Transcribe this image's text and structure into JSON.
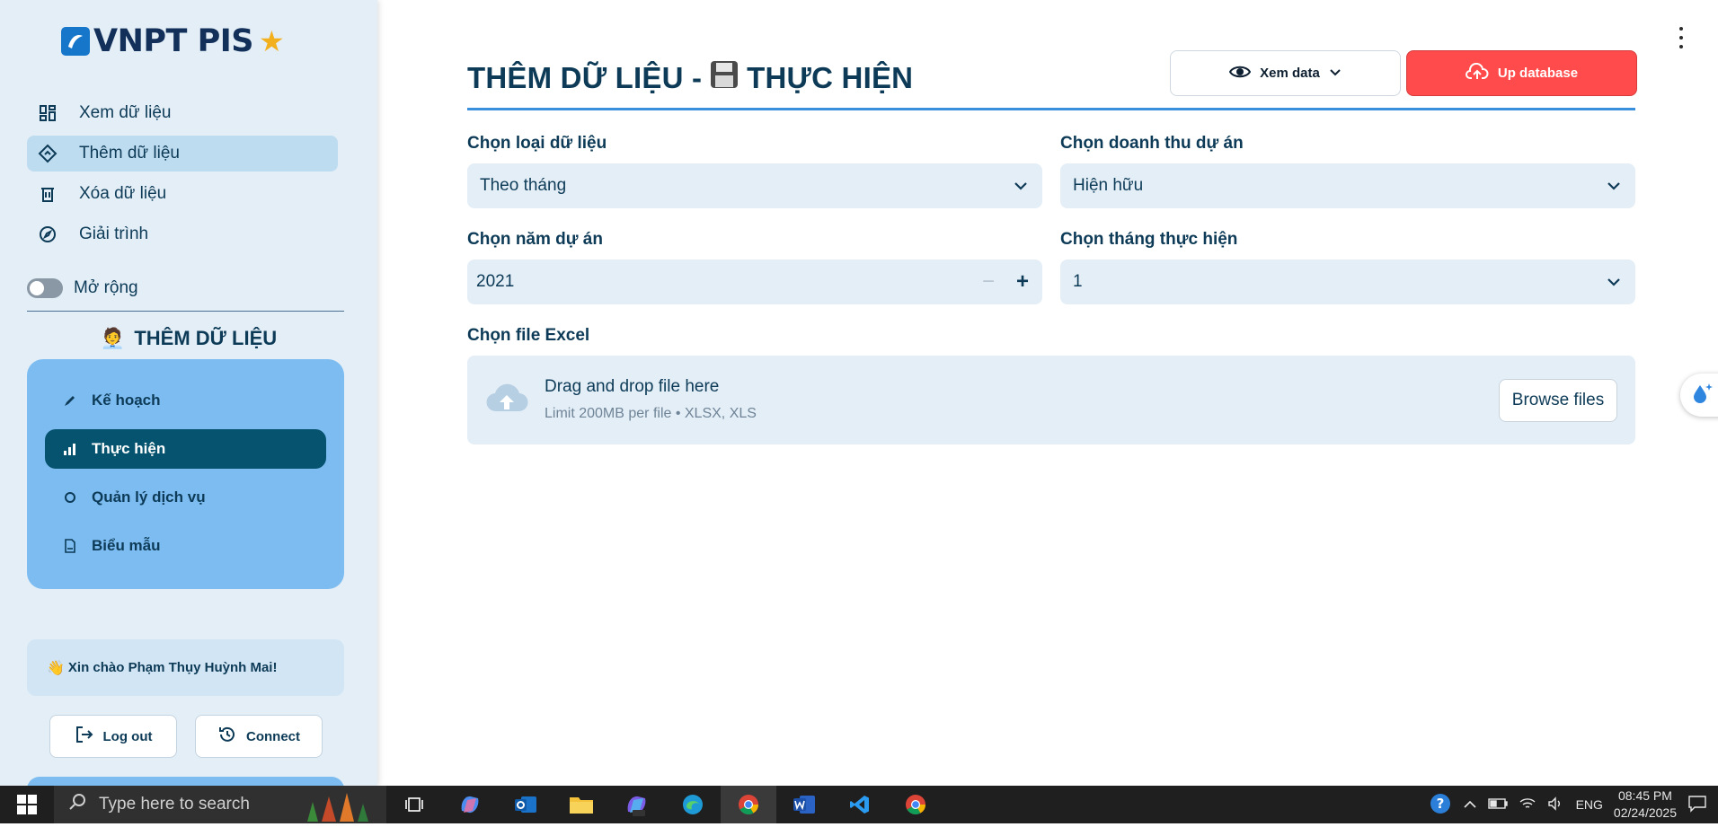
{
  "sidebar": {
    "logo_text": "VNPT PIS",
    "nav": [
      {
        "label": "Xem dữ liệu",
        "icon": "dashboard-icon"
      },
      {
        "label": "Thêm dữ liệu",
        "icon": "diamond-icon",
        "active": true
      },
      {
        "label": "Xóa dữ liệu",
        "icon": "trash-icon"
      },
      {
        "label": "Giải trình",
        "icon": "compass-icon"
      }
    ],
    "toggle_label": "Mở rộng",
    "section_title": "THÊM DỮ LIỆU",
    "menu": [
      {
        "label": "Kế hoạch",
        "icon": "pencil-icon"
      },
      {
        "label": "Thực hiện",
        "icon": "bar-chart-icon",
        "active": true
      },
      {
        "label": "Quản lý dịch vụ",
        "icon": "gear-icon"
      },
      {
        "label": "Biểu mẫu",
        "icon": "document-icon"
      }
    ],
    "greeting": "Xin chào Phạm Thụy Huỳnh Mai!",
    "logout_label": "Log out",
    "connect_label": "Connect"
  },
  "header": {
    "title_prefix": "THÊM DỮ LIỆU -",
    "title_suffix": "THỰC HIỆN",
    "view_button": "Xem data",
    "upload_button": "Up database"
  },
  "form": {
    "data_type_label": "Chọn loại dữ liệu",
    "data_type_value": "Theo tháng",
    "revenue_label": "Chọn doanh thu dự án",
    "revenue_value": "Hiện hữu",
    "year_label": "Chọn năm dự án",
    "year_value": "2021",
    "month_label": "Chọn tháng thực hiện",
    "month_value": "1",
    "file_label": "Chọn file Excel",
    "drop_text": "Drag and drop file here",
    "limit_text": "Limit 200MB per file • XLSX, XLS",
    "browse_label": "Browse files"
  },
  "taskbar": {
    "search_placeholder": "Type here to search",
    "language": "ENG",
    "time": "08:45 PM",
    "date": "02/24/2025"
  },
  "colors": {
    "accent_red": "#ff4b4b",
    "active_menu": "#05536e",
    "menu_card": "#7cbcf1",
    "title_rule": "#3a8fdc"
  }
}
